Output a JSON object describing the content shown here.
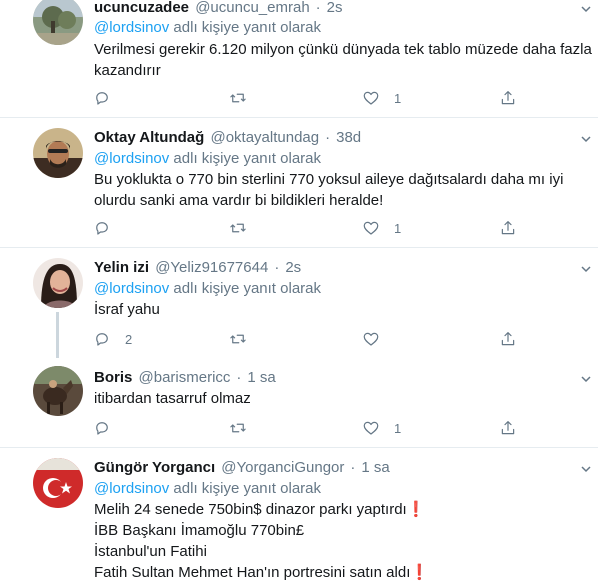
{
  "tweets": [
    {
      "name": "ucuncuzadee",
      "handle": "@ucuncu_emrah",
      "time": "2s",
      "reply_to": "@lordsinov",
      "reply_suffix": " adlı kişiye yanıt olarak",
      "lines": [
        "Verilmesi gerekir 6.120 milyon çünkü dünyada tek tablo müzede daha fazla",
        "kazandırır"
      ],
      "replies": "",
      "retweets": "",
      "likes": "1"
    },
    {
      "name": "Oktay Altundağ",
      "handle": "@oktayaltundag",
      "time": "38d",
      "reply_to": "@lordsinov",
      "reply_suffix": " adlı kişiye yanıt olarak",
      "lines": [
        "Bu yoklukta o 770 bin sterlini 770 yoksul aileye dağıtsalardı daha mı iyi",
        "olurdu sanki ama vardır bi bildikleri heralde!"
      ],
      "replies": "",
      "retweets": "",
      "likes": "1"
    },
    {
      "name": "Yelin izi",
      "handle": "@Yeliz91677644",
      "time": "2s",
      "reply_to": "@lordsinov",
      "reply_suffix": " adlı kişiye yanıt olarak",
      "lines": [
        "İsraf yahu"
      ],
      "replies": "2",
      "retweets": "",
      "likes": ""
    },
    {
      "name": "Boris",
      "handle": "@barismericc",
      "time": "1 sa",
      "lines": [
        "itibardan tasarruf olmaz"
      ],
      "replies": "",
      "retweets": "",
      "likes": "1"
    },
    {
      "name": "Güngör Yorgancı",
      "handle": "@YorganciGungor",
      "time": "1 sa",
      "reply_to": "@lordsinov",
      "reply_suffix": " adlı kişiye yanıt olarak",
      "lines": [
        "Melih 24 senede 750bin$ dinazor parkı yaptırdı",
        "İBB Başkanı İmamoğlu 770bin£",
        "İstanbul'un Fatihi",
        "Fatih Sultan Mehmet Han'ın portresini satın aldı"
      ],
      "exclaim": "❗"
    }
  ],
  "icons": {
    "reply": "reply-icon",
    "retweet": "retweet-icon",
    "like": "heart-icon",
    "share": "share-icon",
    "more": "chevron-down-icon"
  },
  "colors": {
    "link": "#1da1f2",
    "secondary": "#657786",
    "text": "#14171a",
    "divider": "#e6ecf0",
    "thread": "#ccd6dd",
    "exclaim": "#dd2e44"
  }
}
